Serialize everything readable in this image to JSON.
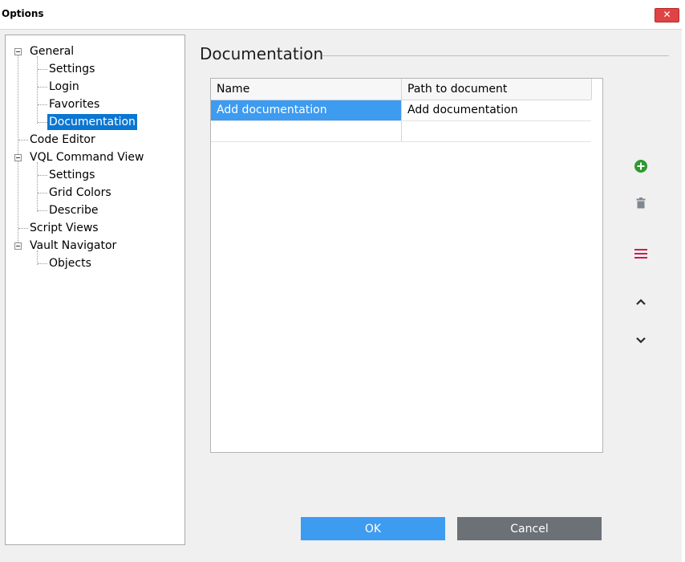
{
  "window": {
    "title": "Options",
    "close_label": "✕"
  },
  "tree": {
    "items": [
      {
        "label": "General"
      },
      {
        "label": "Settings"
      },
      {
        "label": "Login"
      },
      {
        "label": "Favorites"
      },
      {
        "label": "Documentation",
        "selected": true
      },
      {
        "label": "Code Editor"
      },
      {
        "label": "VQL Command View"
      },
      {
        "label": "Settings"
      },
      {
        "label": "Grid Colors"
      },
      {
        "label": "Describe"
      },
      {
        "label": "Script Views"
      },
      {
        "label": "Vault Navigator"
      },
      {
        "label": "Objects"
      }
    ]
  },
  "section": {
    "title": "Documentation"
  },
  "grid": {
    "columns": [
      "Name",
      "Path to document"
    ],
    "rows": [
      {
        "name": "Add documentation",
        "path": "Add documentation",
        "selected": true
      },
      {
        "name": "",
        "path": ""
      }
    ]
  },
  "actions": [
    {
      "icon": "add-circle-icon",
      "color": "#2e9a2e"
    },
    {
      "icon": "trash-icon",
      "color": "#7f8890"
    },
    {
      "icon": "menu-icon",
      "color": "#d11a4c"
    },
    {
      "icon": "chevron-up-icon",
      "color": "#2a2a2a"
    },
    {
      "icon": "chevron-down-icon",
      "color": "#2a2a2a"
    }
  ],
  "buttons": {
    "ok": "OK",
    "cancel": "Cancel"
  },
  "colors": {
    "accent": "#3d9bf0",
    "tree_selection": "#0b76d2",
    "cancel_button": "#6b7177",
    "close_button": "#e04343"
  }
}
